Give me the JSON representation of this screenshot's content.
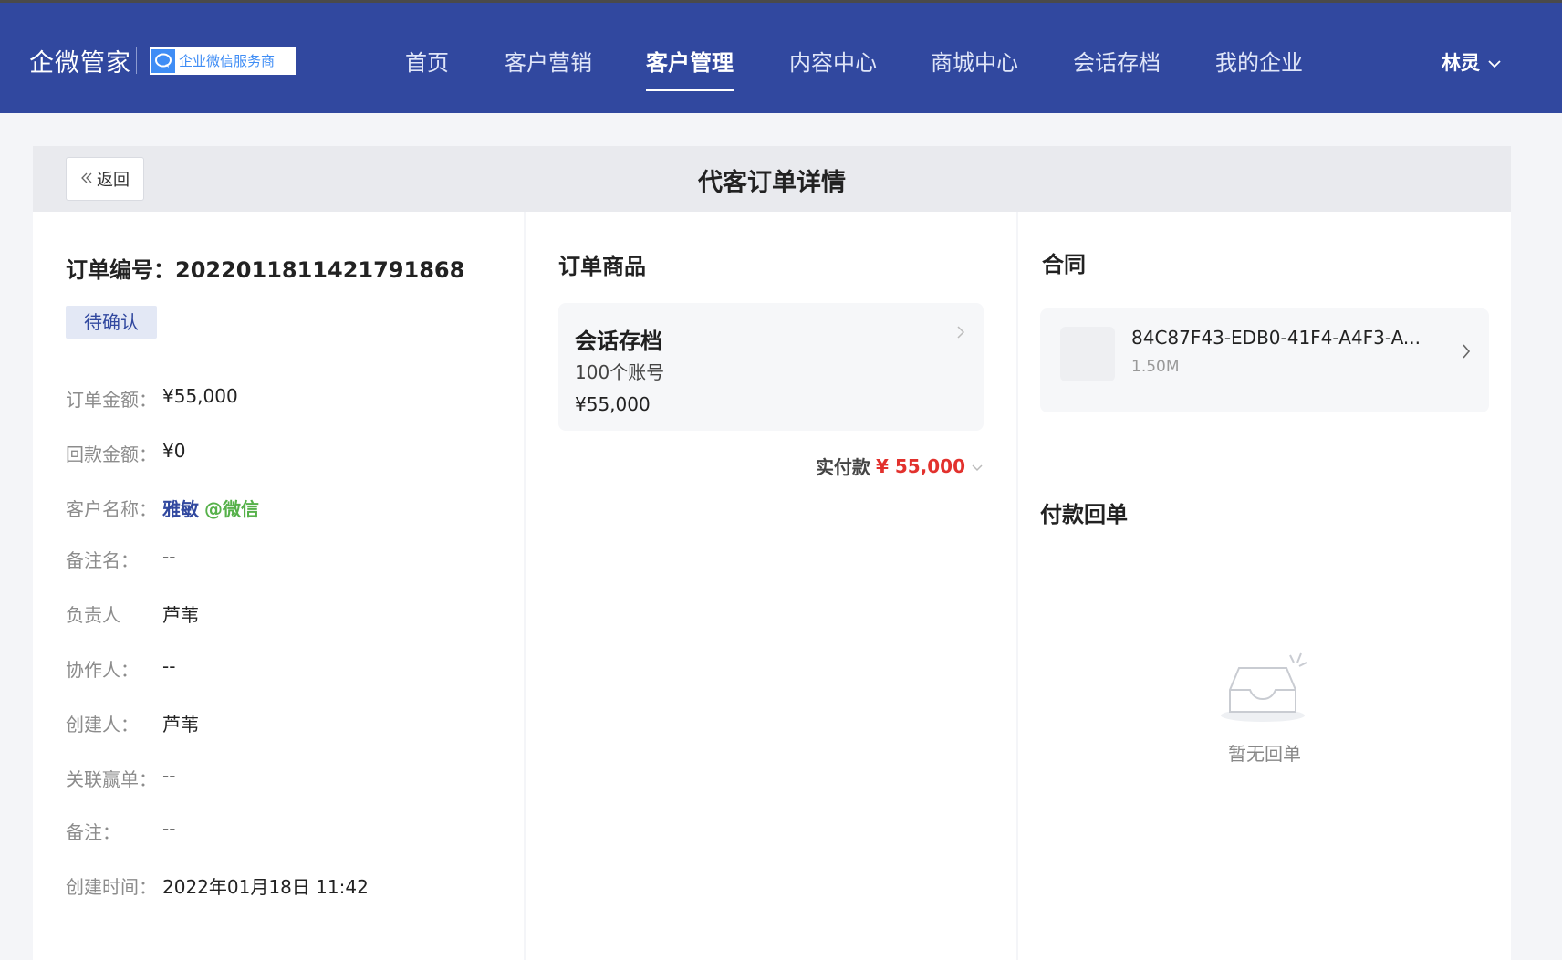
{
  "topbar": {
    "brand": "企微管家",
    "partner_badge": "企业微信服务商",
    "nav": [
      {
        "label": "首页"
      },
      {
        "label": "客户营销"
      },
      {
        "label": "客户管理",
        "active": true
      },
      {
        "label": "内容中心"
      },
      {
        "label": "商城中心"
      },
      {
        "label": "会话存档"
      },
      {
        "label": "我的企业"
      }
    ],
    "user": "林灵",
    "colors": {
      "bar": "#31489f",
      "badge": "#3f8df5"
    }
  },
  "header": {
    "back_label": "返回",
    "title": "代客订单详情"
  },
  "order": {
    "number_label": "订单编号：",
    "number": "2022011811421791868",
    "status": "待确认",
    "fields": {
      "amount": {
        "k": "订单金额：",
        "v": "¥55,000"
      },
      "refund": {
        "k": "回款金额：",
        "v": "¥0"
      },
      "customer": {
        "k": "客户名称：",
        "name": "雅敏",
        "source": "@微信"
      },
      "remark_name": {
        "k": "备注名：",
        "v": "--"
      },
      "owner": {
        "k": "负责人",
        "v": "芦苇"
      },
      "collaborator": {
        "k": "协作人：",
        "v": "--"
      },
      "creator": {
        "k": "创建人：",
        "v": "芦苇"
      },
      "linked_deal": {
        "k": "关联赢单：",
        "v": "--"
      },
      "note": {
        "k": "备注：",
        "v": "--"
      },
      "created_at": {
        "k": "创建时间：",
        "v": "2022年01月18日 11:42"
      }
    }
  },
  "products": {
    "title": "订单商品",
    "items": [
      {
        "name": "会话存档",
        "spec": "100个账号",
        "price": "¥55,000"
      }
    ],
    "paid_label": "实付款",
    "paid_amount": "¥ 55,000",
    "paid_color": "#e2312d"
  },
  "contract": {
    "title": "合同",
    "file_name": "84C87F43-EDB0-41F4-A4F3-A...",
    "file_size": "1.50M"
  },
  "receipt": {
    "title": "付款回单",
    "empty_text": "暂无回单"
  }
}
